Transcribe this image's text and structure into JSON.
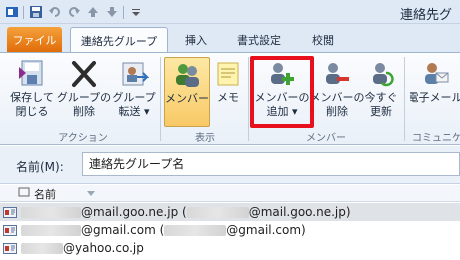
{
  "window": {
    "title": "連絡先グ"
  },
  "tabs": [
    {
      "label": "ファイル",
      "id": "file"
    },
    {
      "label": "連絡先グループ",
      "id": "contact-group",
      "active": true
    },
    {
      "label": "挿入",
      "id": "insert"
    },
    {
      "label": "書式設定",
      "id": "format"
    },
    {
      "label": "校閲",
      "id": "review"
    }
  ],
  "ribbon": {
    "save_close": "保存して\n閉じる",
    "delete_group": "グループの\n削除",
    "forward_group": "グループ\n転送 ▾",
    "members": "メンバー",
    "notes": "メモ",
    "add_members": "メンバーの\n追加 ▾",
    "remove_member": "メンバーの\n削除",
    "update_now": "今すぐ\n更新",
    "email": "電子メール",
    "groups": {
      "actions": "アクション",
      "show": "表示",
      "members": "メンバー",
      "communicate": "コミュニケ"
    }
  },
  "name_field": {
    "label": "名前(M):",
    "value": "連絡先グループ名"
  },
  "list": {
    "column_name": "名前",
    "rows": [
      {
        "text": "@mail.goo.ne.jp (",
        "text2": "@mail.goo.ne.jp)",
        "selected": true
      },
      {
        "text": "@gmail.com (",
        "text2": "@gmail.com)",
        "selected": false
      },
      {
        "text": "@yahoo.co.jp",
        "text2": "",
        "selected": false
      }
    ]
  },
  "colors": {
    "file_tab": "#e06d0a",
    "highlight_box": "#e8101c",
    "pressed_button": "#f8c966"
  }
}
